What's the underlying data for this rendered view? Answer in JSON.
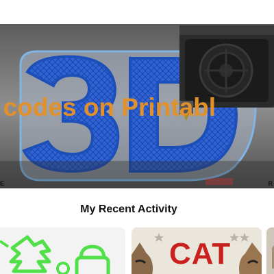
{
  "hero": {
    "headline": "t codes on Printabl",
    "mark_left": "E",
    "mark_right": "R"
  },
  "activity": {
    "title": "My Recent Activity"
  },
  "cards": [
    {
      "name": "green-cookie-cutters"
    },
    {
      "name": "cat-sign",
      "sign_text": "CAT"
    },
    {
      "name": "third-item"
    }
  ],
  "colors": {
    "headline": "#e2902a",
    "filament_blue": "#2a5fd0",
    "filament_green": "#52e04a",
    "cat_red": "#c9211e"
  }
}
